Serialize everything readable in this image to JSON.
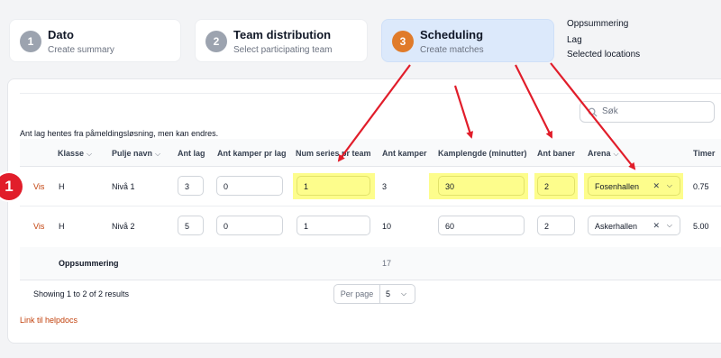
{
  "steps": [
    {
      "num": "1",
      "title": "Dato",
      "sub": "Create summary"
    },
    {
      "num": "2",
      "title": "Team distribution",
      "sub": "Select participating team"
    },
    {
      "num": "3",
      "title": "Scheduling",
      "sub": "Create matches"
    }
  ],
  "side_links": [
    "Oppsummering",
    "Lag",
    "Selected locations"
  ],
  "search": {
    "placeholder": "Søk"
  },
  "note": "Ant lag hentes fra påmeldingsløsning, men kan endres.",
  "columns": {
    "klasse": "Klasse",
    "pulje": "Pulje navn",
    "ant_lag": "Ant lag",
    "ant_kamper_pr_lag": "Ant kamper pr lag",
    "num_series": "Num series pr team",
    "ant_kamper": "Ant kamper",
    "kamplengde": "Kamplengde (minutter)",
    "ant_baner": "Ant baner",
    "arena": "Arena",
    "timer": "Timer"
  },
  "rows": [
    {
      "action": "Vis",
      "klasse": "H",
      "pulje": "Nivå 1",
      "ant_lag": "3",
      "ant_kamper_pr_lag": "0",
      "num_series": "1",
      "ant_kamper": "3",
      "kamplengde": "30",
      "ant_baner": "2",
      "arena": "Fosenhallen",
      "timer": "0.75"
    },
    {
      "action": "Vis",
      "klasse": "H",
      "pulje": "Nivå 2",
      "ant_lag": "5",
      "ant_kamper_pr_lag": "0",
      "num_series": "1",
      "ant_kamper": "10",
      "kamplengde": "60",
      "ant_baner": "2",
      "arena": "Askerhallen",
      "timer": "5.00"
    }
  ],
  "summary": {
    "label": "Oppsummering",
    "total": "17"
  },
  "footer": {
    "showing": "Showing 1 to 2 of 2 results",
    "per_page_label": "Per page",
    "per_page_value": "5"
  },
  "help_link": "Link til helpdocs",
  "badge": "1",
  "colors": {
    "accent": "#e07b2a",
    "highlight": "#fdfd8c",
    "arrow": "#e11d2a",
    "link": "#c2410c"
  }
}
